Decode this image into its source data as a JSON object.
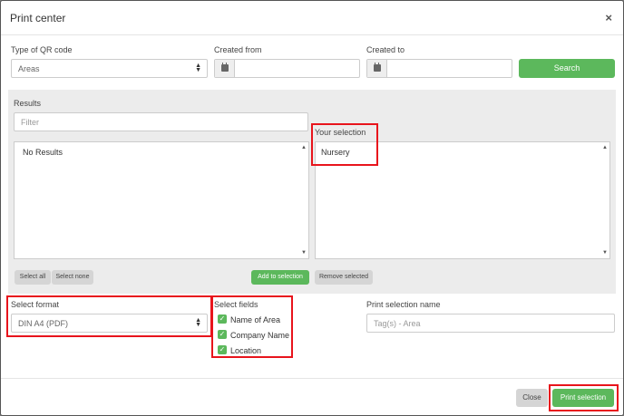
{
  "modal": {
    "title": "Print center",
    "close_label": "×"
  },
  "filters": {
    "qr_type_label": "Type of QR code",
    "qr_type_value": "Areas",
    "created_from_label": "Created from",
    "created_from_value": "",
    "created_to_label": "Created to",
    "created_to_value": "",
    "search_button": "Search"
  },
  "results": {
    "label": "Results",
    "filter_placeholder": "Filter",
    "empty_text": "No Results",
    "select_all": "Select all",
    "select_none": "Select none",
    "add_to_selection": "Add to selection"
  },
  "selection": {
    "label": "Your selection",
    "items": [
      "Nursery"
    ],
    "remove_selected": "Remove selected"
  },
  "format": {
    "label": "Select format",
    "value": "DIN A4 (PDF)"
  },
  "fields": {
    "label": "Select fields",
    "items": [
      {
        "label": "Name of Area",
        "checked": true
      },
      {
        "label": "Company Name",
        "checked": true
      },
      {
        "label": "Location",
        "checked": true
      }
    ]
  },
  "print_name": {
    "label": "Print selection name",
    "placeholder": "Tag(s) - Area"
  },
  "footer": {
    "close_button": "Close",
    "print_button": "Print selection"
  },
  "colors": {
    "accent_green": "#5cb85c",
    "highlight_red": "#e8141c"
  }
}
